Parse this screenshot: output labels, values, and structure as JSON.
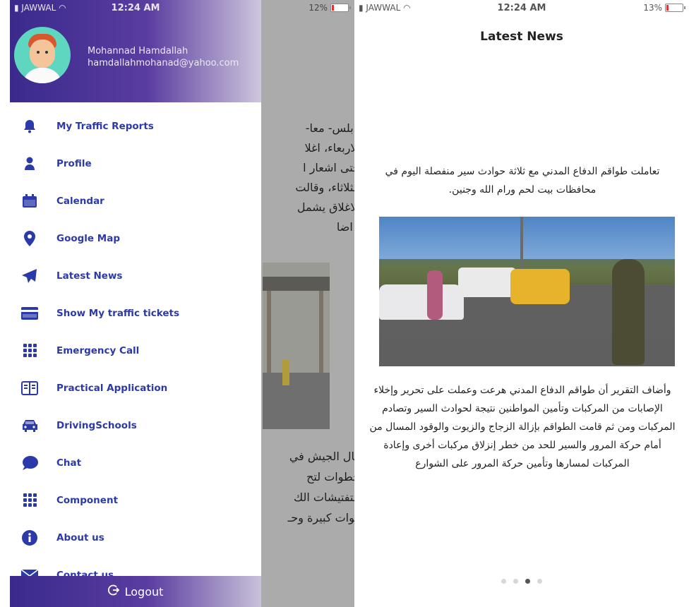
{
  "left_screen": {
    "status": {
      "carrier": "JAWWAL",
      "time": "12:24 AM",
      "battery": "12%"
    },
    "user": {
      "name": "Mohannad Hamdallah",
      "email": "hamdallahmohanad@yahoo.com"
    },
    "menu": [
      {
        "label": "My Traffic Reports",
        "icon": "bell-icon"
      },
      {
        "label": "Profile",
        "icon": "person-icon"
      },
      {
        "label": "Calendar",
        "icon": "calendar-icon"
      },
      {
        "label": "Google Map",
        "icon": "map-pin-icon"
      },
      {
        "label": "Latest News",
        "icon": "send-icon"
      },
      {
        "label": "Show My traffic tickets",
        "icon": "credit-card-icon"
      },
      {
        "label": "Emergency Call",
        "icon": "dialpad-icon"
      },
      {
        "label": "Practical Application",
        "icon": "book-icon"
      },
      {
        "label": "DrivingSchools",
        "icon": "car-icon"
      },
      {
        "label": "Chat",
        "icon": "chat-icon"
      },
      {
        "label": "Component",
        "icon": "grid-icon"
      },
      {
        "label": "About us",
        "icon": "info-icon"
      },
      {
        "label": "Contact us",
        "icon": "mail-icon"
      }
    ],
    "logout_label": "Logout",
    "background_text_top": [
      "نابلس- معا-",
      "الاربعاء، اغلا",
      "حتى اشعار ا",
      "الثلاثاء، وقالت",
      "الاغلاق يشمل",
      ". اضا"
    ],
    "background_text_bottom": [
      "قال الجيش في",
      "خطوات لتح",
      "التفتيشات الك",
      "قوات كبيرة وحـ"
    ]
  },
  "right_screen": {
    "status": {
      "carrier": "JAWWAL",
      "time": "12:24 AM",
      "battery": "13%"
    },
    "title": "Latest News",
    "paragraph1": "تعاملت طواقم الدفاع المدني مع ثلاثة حوادث سير منفصلة اليوم في محافظات بيت لحم ورام الله وجنين.",
    "paragraph2": "وأضاف التقرير أن طواقم الدفاع المدني هرعت وعملت على تحرير وإخلاء الإصابات من المركبات وتأمين المواطنين نتيجة لحوادث السير وتصادم المركبات ومن ثم قامت الطواقم بإزالة الزجاج والزيوت والوقود المسال من أمام حركة المرور والسير للحد من خطر إنزلاق مركبات أخرى وإعادة المركبات لمسارها وتأمين حركة المرور على الشوارع",
    "pager": {
      "pages": 4,
      "active": 3
    }
  },
  "colors": {
    "accent": "#2b3aa8",
    "header_gradient_start": "#3a2a8c",
    "battery_low": "#e53030"
  }
}
